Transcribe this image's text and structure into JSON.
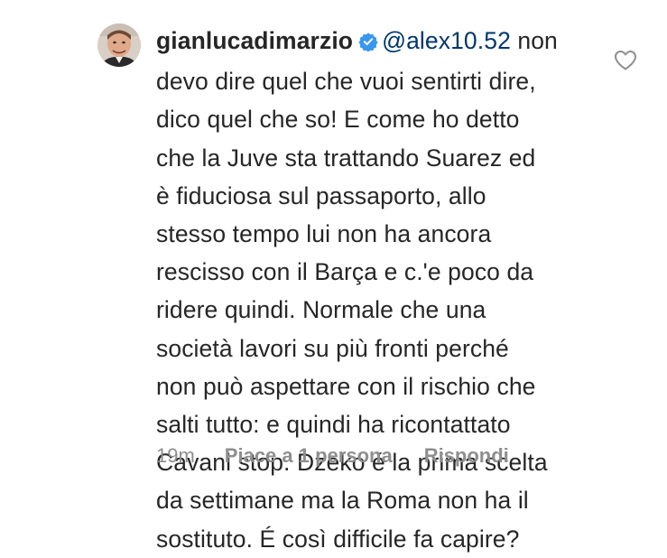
{
  "comment": {
    "username": "gianlucadimarzio",
    "verified_icon": "verified-badge-icon",
    "mention": "@alex10.52",
    "first_line_rest": " non",
    "lines": [
      "devo dire quel che vuoi sentirti dire,",
      "dico quel che so! E come ho detto",
      "che la Juve sta trattando Suarez ed",
      "è fiduciosa sul passaporto, allo",
      "stesso tempo lui non ha ancora",
      "rescisso con il Barça e c.'e poco da",
      "ridere quindi. Normale che una",
      "società lavori su più fronti perché",
      "non può aspettare con il rischio che",
      "salti tutto: e quindi ha ricontattato",
      "Cavani stop. Dzeko é la prima scelta",
      "da settimane ma la Roma non ha il",
      "sostituto. É così difficile fa capire?"
    ],
    "time": "19m",
    "likes_label": "Piace a 1 persona",
    "reply_label": "Rispondi",
    "like_icon": "heart-outline-icon"
  },
  "colors": {
    "text": "#262626",
    "mention": "#00376b",
    "meta": "#8e8e8e",
    "verified": "#3897f0"
  }
}
